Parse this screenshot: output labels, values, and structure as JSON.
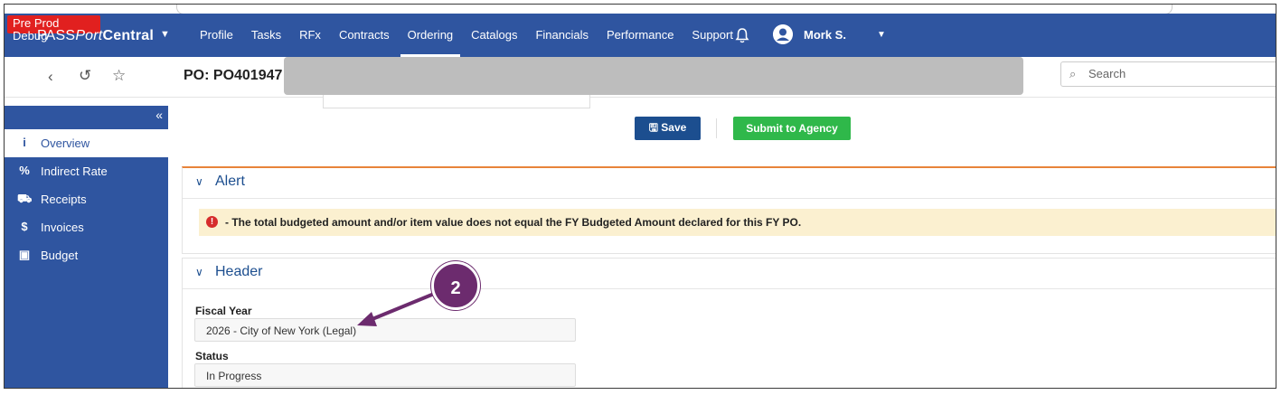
{
  "env_badge": "Pre Prod Debug",
  "brand": {
    "part1": "PASS",
    "part2": "Port",
    "part3": "Central"
  },
  "nav": [
    "Profile",
    "Tasks",
    "RFx",
    "Contracts",
    "Ordering",
    "Catalogs",
    "Financials",
    "Performance",
    "Support"
  ],
  "active_nav": "Ordering",
  "user": {
    "name": "Mork S."
  },
  "po_title": "PO: PO401947",
  "search": {
    "placeholder": "Search"
  },
  "sidebar": {
    "items": [
      {
        "icon": "info-icon",
        "glyph": "i",
        "label": "Overview",
        "active": true
      },
      {
        "icon": "percent-icon",
        "glyph": "%",
        "label": "Indirect Rate",
        "active": false
      },
      {
        "icon": "truck-icon",
        "glyph": "⛟",
        "label": "Receipts",
        "active": false
      },
      {
        "icon": "dollar-icon",
        "glyph": "$",
        "label": "Invoices",
        "active": false
      },
      {
        "icon": "money-icon",
        "glyph": "▣",
        "label": "Budget",
        "active": false
      }
    ]
  },
  "actions": {
    "save": "Save",
    "submit": "Submit to Agency"
  },
  "alert_panel": {
    "title": "Alert",
    "message": "- The total budgeted amount and/or item value does not equal the FY Budgeted Amount declared for this FY PO."
  },
  "header_panel": {
    "title": "Header",
    "fields": [
      {
        "label": "Fiscal Year",
        "value": "2026 - City of New York (Legal)"
      },
      {
        "label": "Status",
        "value": "In Progress"
      }
    ]
  },
  "annotation": {
    "number": "2",
    "color": "#6c2b6e"
  },
  "colors": {
    "nav_bg": "#2f55a0",
    "save_btn": "#1c4e8f",
    "submit_btn": "#2fb84a",
    "debug_badge": "#e1201f"
  }
}
